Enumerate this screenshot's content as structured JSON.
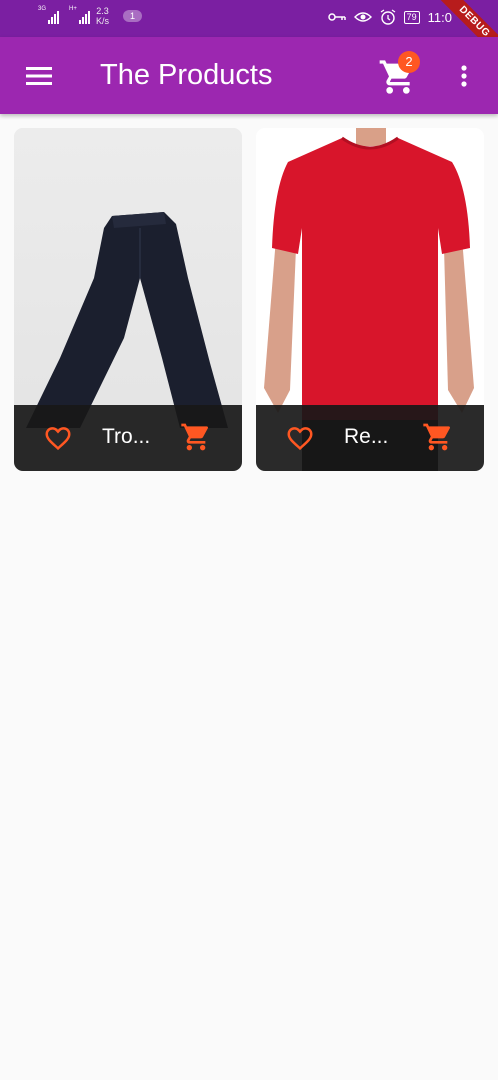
{
  "status_bar": {
    "net1": "3G",
    "net2": "H+",
    "speed_value": "2.3",
    "speed_unit": "K/s",
    "notification_count": "1",
    "battery": "79",
    "time": "11:0"
  },
  "debug_banner": "DEBUG",
  "app_bar": {
    "title": "The Products",
    "cart_count": "2"
  },
  "products": [
    {
      "name": "Tro..."
    },
    {
      "name": "Re..."
    }
  ],
  "colors": {
    "status_bar": "#7b1fa2",
    "app_bar": "#9c27b0",
    "accent": "#ff5722",
    "card_footer": "#181818",
    "background": "#fafafa"
  },
  "icons": [
    "menu-icon",
    "cart-icon",
    "more-vert-icon",
    "heart-outline-icon",
    "add-shopping-cart-icon",
    "key-icon",
    "eye-icon",
    "alarm-icon"
  ]
}
